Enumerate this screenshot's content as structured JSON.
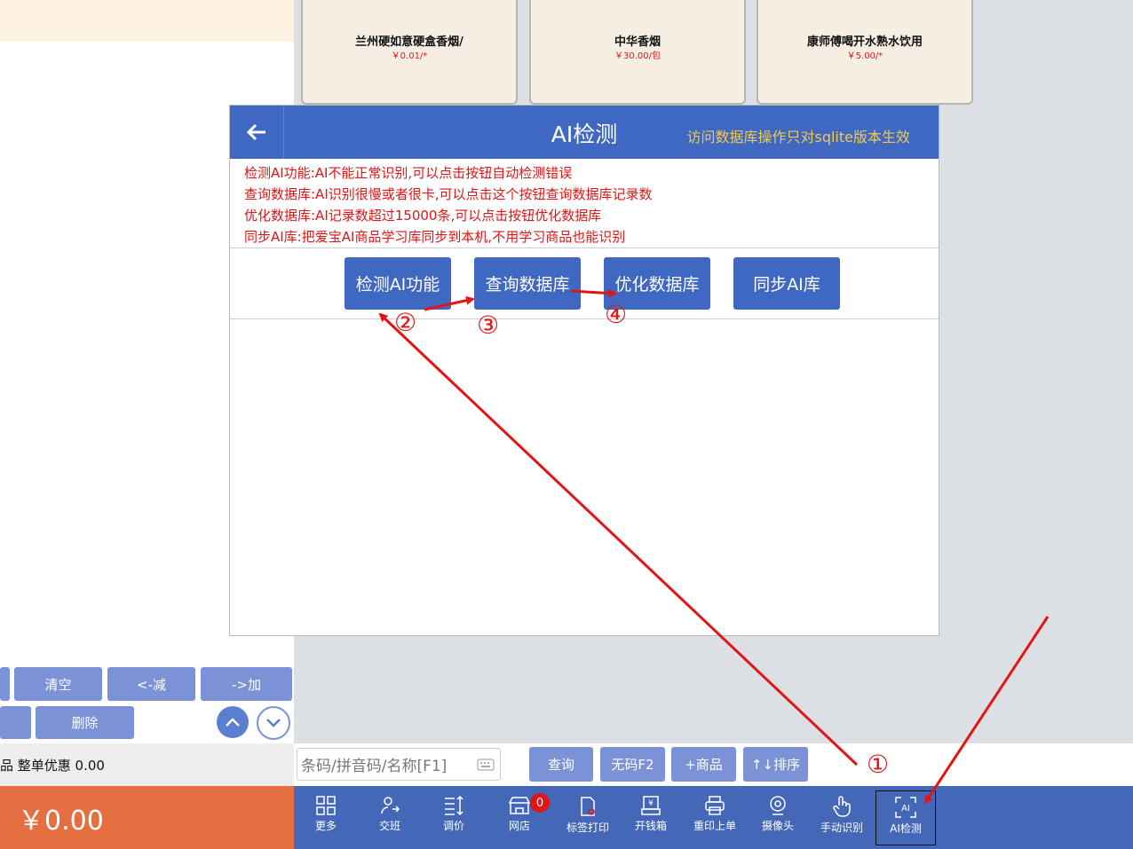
{
  "products": [
    {
      "name": "兰州硬如意硬盒香烟/",
      "price": "￥0.01/*"
    },
    {
      "name": "中华香烟",
      "price": "￥30.00/包"
    },
    {
      "name": "康师傅喝开水熟水饮用",
      "price": "￥5.00/*"
    }
  ],
  "keypad": {
    "clear": "清空",
    "minus": "<-减",
    "plus": "->加",
    "delete": "删除"
  },
  "discount_text": "品 整单优惠 0.00",
  "total": "￥0.00",
  "search": {
    "placeholder": "条码/拼音码/名称[F1]",
    "query": "查询",
    "no_code": "无码F2",
    "add_product": "+商品",
    "sort": "↑↓排序"
  },
  "toolbar": [
    {
      "label": "更多",
      "icon": "grid-icon"
    },
    {
      "label": "交班",
      "icon": "user-swap-icon"
    },
    {
      "label": "调价",
      "icon": "price-adjust-icon"
    },
    {
      "label": "网店",
      "icon": "shop-icon"
    },
    {
      "label": "标签打印",
      "icon": "label-print-icon"
    },
    {
      "label": "开钱箱",
      "icon": "cash-box-icon"
    },
    {
      "label": "重印上单",
      "icon": "printer-icon"
    },
    {
      "label": "摄像头",
      "icon": "camera-icon"
    },
    {
      "label": "手动识别",
      "icon": "hand-tap-icon"
    },
    {
      "label": "AI检测",
      "icon": "ai-scan-icon"
    }
  ],
  "shop_badge": "0",
  "modal": {
    "title": "AI检测",
    "note": "访问数据库操作只对sqlite版本生效",
    "descriptions": [
      "检测AI功能:AI不能正常识别,可以点击按钮自动检测错误",
      "查询数据库:AI识别很慢或者很卡,可以点击这个按钮查询数据库记录数",
      "优化数据库:AI记录数超过15000条,可以点击按钮优化数据库",
      "同步AI库:把爱宝AI商品学习库同步到本机,不用学习商品也能识别"
    ],
    "buttons": [
      "检测AI功能",
      "查询数据库",
      "优化数据库",
      "同步AI库"
    ]
  },
  "annotations": [
    "①",
    "②",
    "③",
    "④"
  ],
  "colors": {
    "accent": "#3f68c2",
    "toolbar": "#4467b8",
    "total_bg": "#e66f42",
    "annotation": "#e01515",
    "note": "#f2c94c"
  }
}
